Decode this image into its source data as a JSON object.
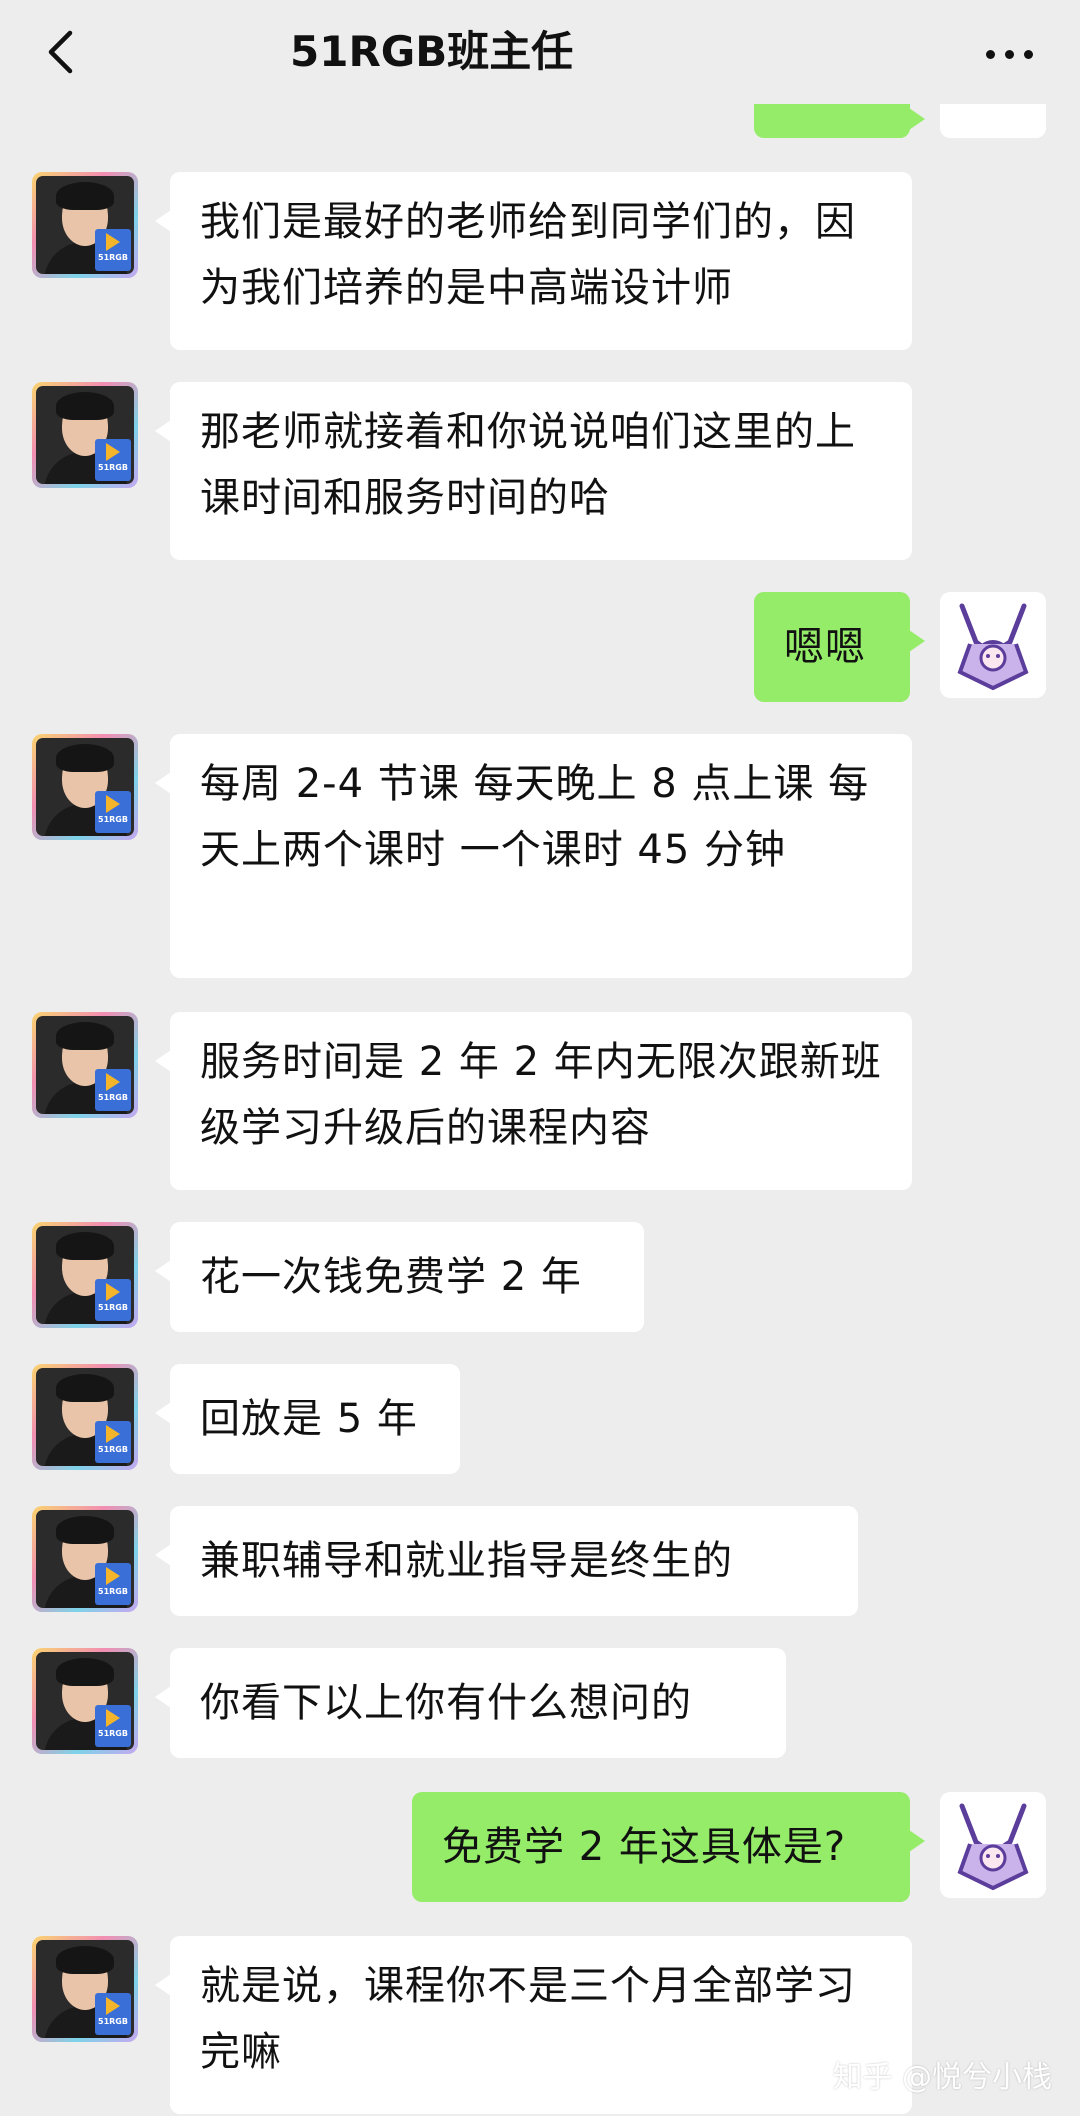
{
  "header": {
    "title": "51RGB班主任",
    "back_icon": "chevron-left-icon",
    "more_icon": "more-dots-icon"
  },
  "contact": {
    "avatar_badge": "51RGB"
  },
  "messages": [
    {
      "sender": "teacher",
      "text": "我们是最好的老师给到同学们的，因为我们培养的是中高端设计师"
    },
    {
      "sender": "teacher",
      "text": "那老师就接着和你说说咱们这里的上课时间和服务时间的哈"
    },
    {
      "sender": "me",
      "text": "嗯嗯"
    },
    {
      "sender": "teacher",
      "text": "每周 2-4 节课  每天晚上 8 点上课  每天上两个课时 一个课时 45 分钟"
    },
    {
      "sender": "teacher",
      "text": "服务时间是 2 年  2 年内无限次跟新班级学习升级后的课程内容"
    },
    {
      "sender": "teacher",
      "text": "花一次钱免费学 2 年"
    },
    {
      "sender": "teacher",
      "text": "回放是 5 年"
    },
    {
      "sender": "teacher",
      "text": "兼职辅导和就业指导是终生的"
    },
    {
      "sender": "teacher",
      "text": "你看下以上你有什么想问的"
    },
    {
      "sender": "me",
      "text": "免费学 2 年这具体是?"
    },
    {
      "sender": "teacher",
      "text": "就是说，课程你不是三个月全部学习完嘛"
    }
  ],
  "watermark": "知乎 @悦兮小栈",
  "colors": {
    "background": "#ededed",
    "incoming_bubble": "#ffffff",
    "outgoing_bubble": "#95ec69"
  }
}
